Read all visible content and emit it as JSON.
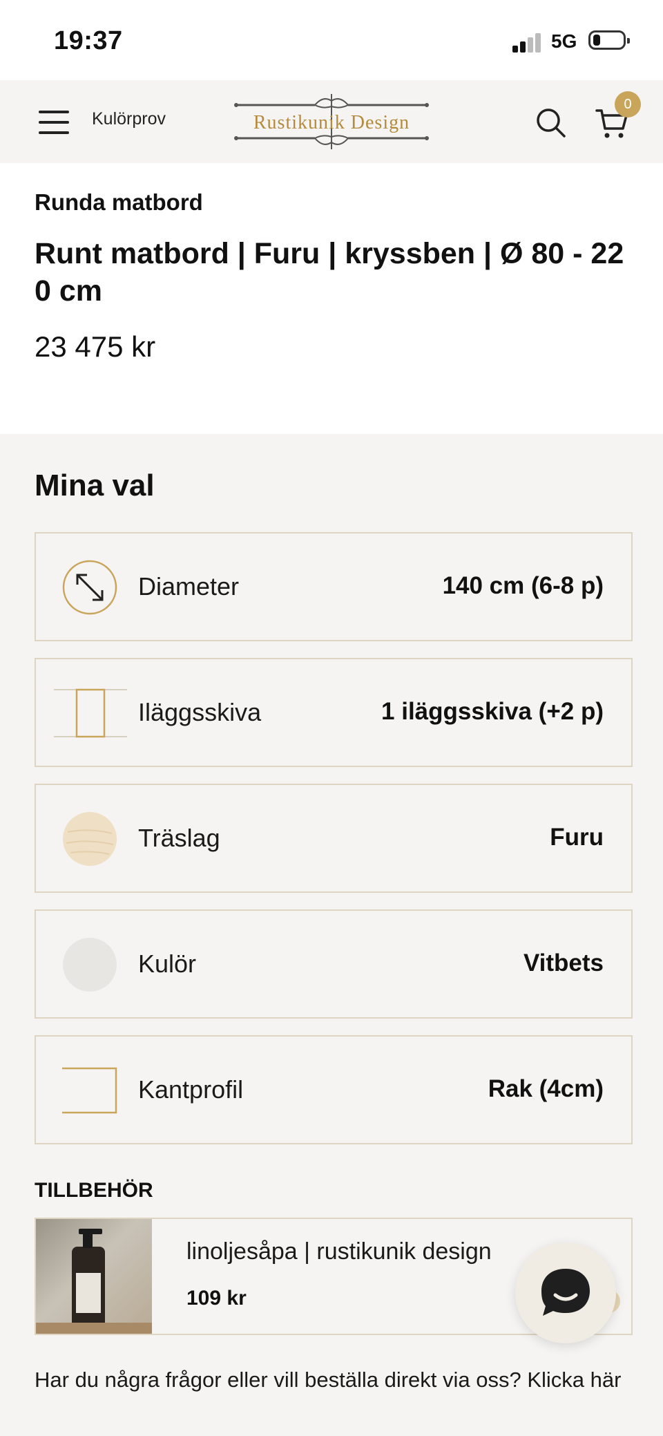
{
  "status_bar": {
    "time": "19:37",
    "network": "5G"
  },
  "header": {
    "link_label": "Kulörprov",
    "logo_text": "Rustikunik Design",
    "cart_count": "0"
  },
  "product": {
    "category": "Runda matbord",
    "title": "Runt matbord | Furu | kryssben | Ø 80 - 220 cm",
    "price": "23 475 kr"
  },
  "choices": {
    "title": "Mina val",
    "items": [
      {
        "label": "Diameter",
        "value": "140 cm (6-8 p)",
        "icon": "resize-arrow-icon"
      },
      {
        "label": "Iläggsskiva",
        "value": "1 iläggsskiva (+2 p)",
        "icon": "extension-leaf-icon"
      },
      {
        "label": "Träslag",
        "value": "Furu",
        "icon": "wood-swatch-icon"
      },
      {
        "label": "Kulör",
        "value": "Vitbets",
        "icon": "color-swatch-icon"
      },
      {
        "label": "Kantprofil",
        "value": "Rak (4cm)",
        "icon": "edge-profile-icon"
      }
    ]
  },
  "accessories": {
    "title": "TILLBEHÖR",
    "items": [
      {
        "name": "linoljesåpa | rustikunik design",
        "price": "109 kr"
      }
    ]
  },
  "help_text": "Har du några frågor eller vill beställa direkt via oss? Klicka här",
  "colors": {
    "accent": "#c9a55c",
    "wood_swatch": "#efdfc4",
    "color_swatch": "#e8e6e3",
    "border": "#ddd5c2"
  }
}
